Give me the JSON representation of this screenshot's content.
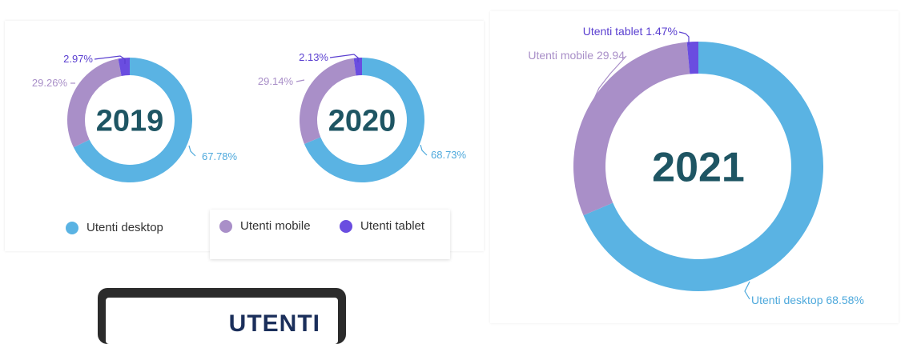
{
  "colors": {
    "desktop": "#5ab3e3",
    "mobile": "#a98fc8",
    "tablet": "#6a4de0",
    "year_text": "#1e5563",
    "desktop_label": "#4ea9dc",
    "mobile_label": "#a98fc8",
    "tablet_label": "#5a3fd0"
  },
  "chart_data": [
    {
      "type": "pie",
      "title": "2019",
      "categories": [
        "Utenti desktop",
        "Utenti mobile",
        "Utenti tablet"
      ],
      "values": [
        67.78,
        29.26,
        2.97
      ],
      "labels": [
        "67.78%",
        "29.26%",
        "2.97%"
      ]
    },
    {
      "type": "pie",
      "title": "2020",
      "categories": [
        "Utenti desktop",
        "Utenti mobile",
        "Utenti tablet"
      ],
      "values": [
        68.73,
        29.14,
        2.13
      ],
      "labels": [
        "68.73%",
        "29.14%",
        "2.13%"
      ]
    },
    {
      "type": "pie",
      "title": "2021",
      "categories": [
        "Utenti desktop",
        "Utenti mobile",
        "Utenti tablet"
      ],
      "values": [
        68.58,
        29.94,
        1.47
      ],
      "labels": [
        "Utenti desktop 68.58%",
        "Utenti mobile 29.94",
        "Utenti tablet 1.47%"
      ]
    }
  ],
  "legend": {
    "desktop": "Utenti desktop",
    "mobile": "Utenti mobile",
    "tablet": "Utenti tablet"
  },
  "tablet_image": {
    "text": "UTENTI"
  }
}
